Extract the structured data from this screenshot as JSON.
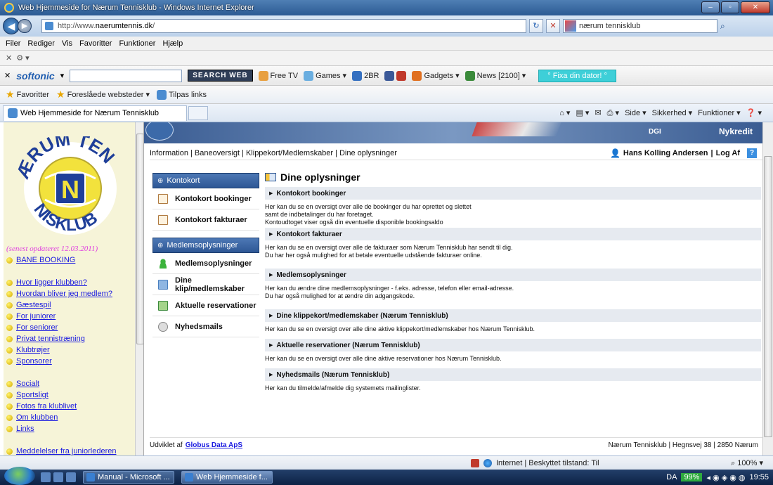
{
  "window": {
    "title": "Web Hjemmeside for Nærum Tennisklub - Windows Internet Explorer"
  },
  "address": {
    "url_prefix": "http://www.",
    "url_domain": "naerumtennis.dk",
    "url_suffix": "/",
    "search_value": "nærum tennisklub"
  },
  "menu": {
    "items": [
      "Filer",
      "Rediger",
      "Vis",
      "Favoritter",
      "Funktioner",
      "Hjælp"
    ]
  },
  "toolbar2": {
    "brand": "softonic",
    "search_web": "SEARCH WEB",
    "free_tv": "Free TV",
    "games": "Games",
    "radio": "2BR",
    "gadgets": "Gadgets",
    "news": "News [2100]",
    "fixa": "° Fixa din dator! °"
  },
  "favorites": {
    "favorites_label": "Favoritter",
    "suggested": "Foreslåede websteder ▾",
    "tilpas": "Tilpas links"
  },
  "tab": {
    "title": "Web Hjemmeside for Nærum Tennisklub"
  },
  "command_bar": {
    "side": "Side ▾",
    "sikkerhed": "Sikkerhed ▾",
    "funktioner": "Funktioner ▾"
  },
  "banner": {
    "dgi": "DGI",
    "nykredit": "Nykredit"
  },
  "left": {
    "updated": "(senest opdateret 12.03.2011)",
    "links_group1": [
      "BANE BOOKING"
    ],
    "links_group2": [
      "Hvor ligger klubben?",
      "Hvordan bliver jeg medlem?",
      "Gæstespil",
      "For juniorer",
      "For seniorer",
      "Privat tennistræning",
      "Klubtrøjer",
      "Sponsorer"
    ],
    "links_group3": [
      "Socialt",
      "Sportsligt",
      "Fotos fra klublivet",
      "Om klubben",
      "Links"
    ],
    "links_group4": [
      "Meddelelser fra juniorlederen"
    ]
  },
  "subnav": {
    "items": [
      "Information",
      "Baneoversigt",
      "Klippekort/Medlemskaber",
      "Dine oplysninger"
    ],
    "user": "Hans Kolling Andersen",
    "logout": "Log Af",
    "help": "?"
  },
  "sidemenu": {
    "group1_header": "Kontokort",
    "group1_items": [
      "Kontokort bookinger",
      "Kontokort fakturaer"
    ],
    "group2_header": "Medlemsoplysninger",
    "group2_items": [
      "Medlemsoplysninger",
      "Dine klip/medlemskaber",
      "Aktuelle reservationer",
      "Nyhedsmails"
    ]
  },
  "content": {
    "title": "Dine oplysninger",
    "sections": [
      {
        "heading": "Kontokort bookinger",
        "lines": [
          "Her kan du se en oversigt over alle de bookinger du har oprettet og slettet",
          "samt de indbetalinger du har foretaget.",
          "Kontoudtoget viser også din eventuelle disponible bookingsaldo"
        ]
      },
      {
        "heading": "Kontokort fakturaer",
        "lines": [
          "Her kan du se en oversigt over alle de fakturaer som Nærum Tennisklub har sendt til dig.",
          "Du har her også mulighed for at betale eventuelle udstående fakturaer online."
        ]
      },
      {
        "heading": "Medlemsoplysninger",
        "lines": [
          "Her kan du ændre dine medlemsoplysninger - f.eks. adresse, telefon eller email-adresse.",
          "Du har også mulighed for at ændre din adgangskode."
        ]
      },
      {
        "heading": "Dine klippekort/medlemskaber (Nærum Tennisklub)",
        "lines": [
          "Her kan du se en oversigt over alle dine aktive klippekort/medlemskaber hos Nærum Tennisklub."
        ]
      },
      {
        "heading": "Aktuelle reservationer (Nærum Tennisklub)",
        "lines": [
          "Her kan du se en oversigt over alle dine aktive reservationer hos Nærum Tennisklub."
        ]
      },
      {
        "heading": "Nyhedsmails (Nærum Tennisklub)",
        "lines": [
          "Her kan du tilmelde/afmelde dig systemets mailinglister."
        ]
      }
    ]
  },
  "footer": {
    "developed_by": "Udviklet af",
    "developer": "Globus Data ApS",
    "address": "Nærum Tennisklub | Hegnsvej 38 | 2850 Nærum"
  },
  "status": {
    "zone": "Internet | Beskyttet tilstand: Til",
    "zoom": "100%"
  },
  "taskbar": {
    "task1": "Manual - Microsoft ...",
    "task2": "Web Hjemmeside f...",
    "lang": "DA",
    "battery": "99%",
    "clock": "19:55"
  }
}
